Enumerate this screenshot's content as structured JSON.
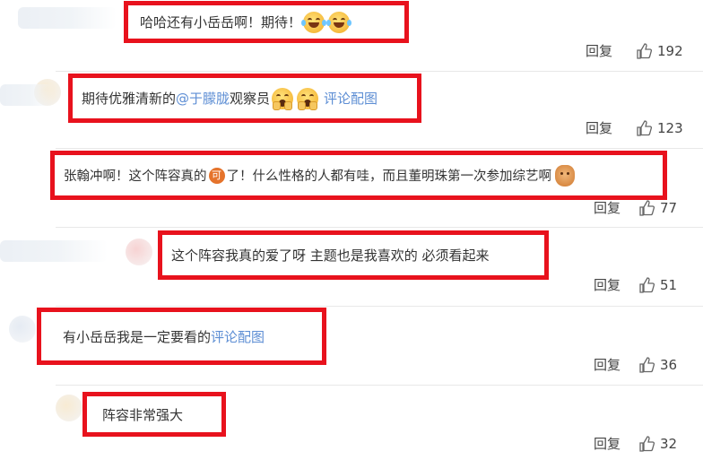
{
  "comments": [
    {
      "id": 1,
      "parts": [
        "哈哈还有小岳岳啊！期待！"
      ],
      "emojis": [
        "laugh-cry-emoji",
        "laugh-cry-emoji"
      ],
      "reply_label": "回复",
      "likes": "192"
    },
    {
      "id": 2,
      "text_before": "期待优雅清新的",
      "mention": "@于朦胧",
      "text_after": " 观察员",
      "emojis": [
        "scared-emoji",
        "scared-emoji"
      ],
      "link": "评论配图",
      "reply_label": "回复",
      "likes": "123"
    },
    {
      "id": 3,
      "text_before": "张翰冲啊！这个阵容真的",
      "icon_text": "可",
      "text_after": "了！什么性格的人都有哇，而且董明珠第一次参加综艺啊",
      "reply_label": "回复",
      "likes": "77"
    },
    {
      "id": 4,
      "text": "这个阵容我真的爱了呀 主题也是我喜欢的 必须看起来",
      "reply_label": "回复",
      "likes": "51"
    },
    {
      "id": 5,
      "text": "有小岳岳我是一定要看的 ",
      "link": "评论配图",
      "reply_label": "回复",
      "likes": "36"
    },
    {
      "id": 6,
      "text": "阵容非常强大",
      "reply_label": "回复",
      "likes": "32"
    }
  ],
  "colors": {
    "highlight_border": "#e8121d",
    "link": "#5d8ed4",
    "text": "#333333",
    "divider": "#e8e8e8"
  }
}
